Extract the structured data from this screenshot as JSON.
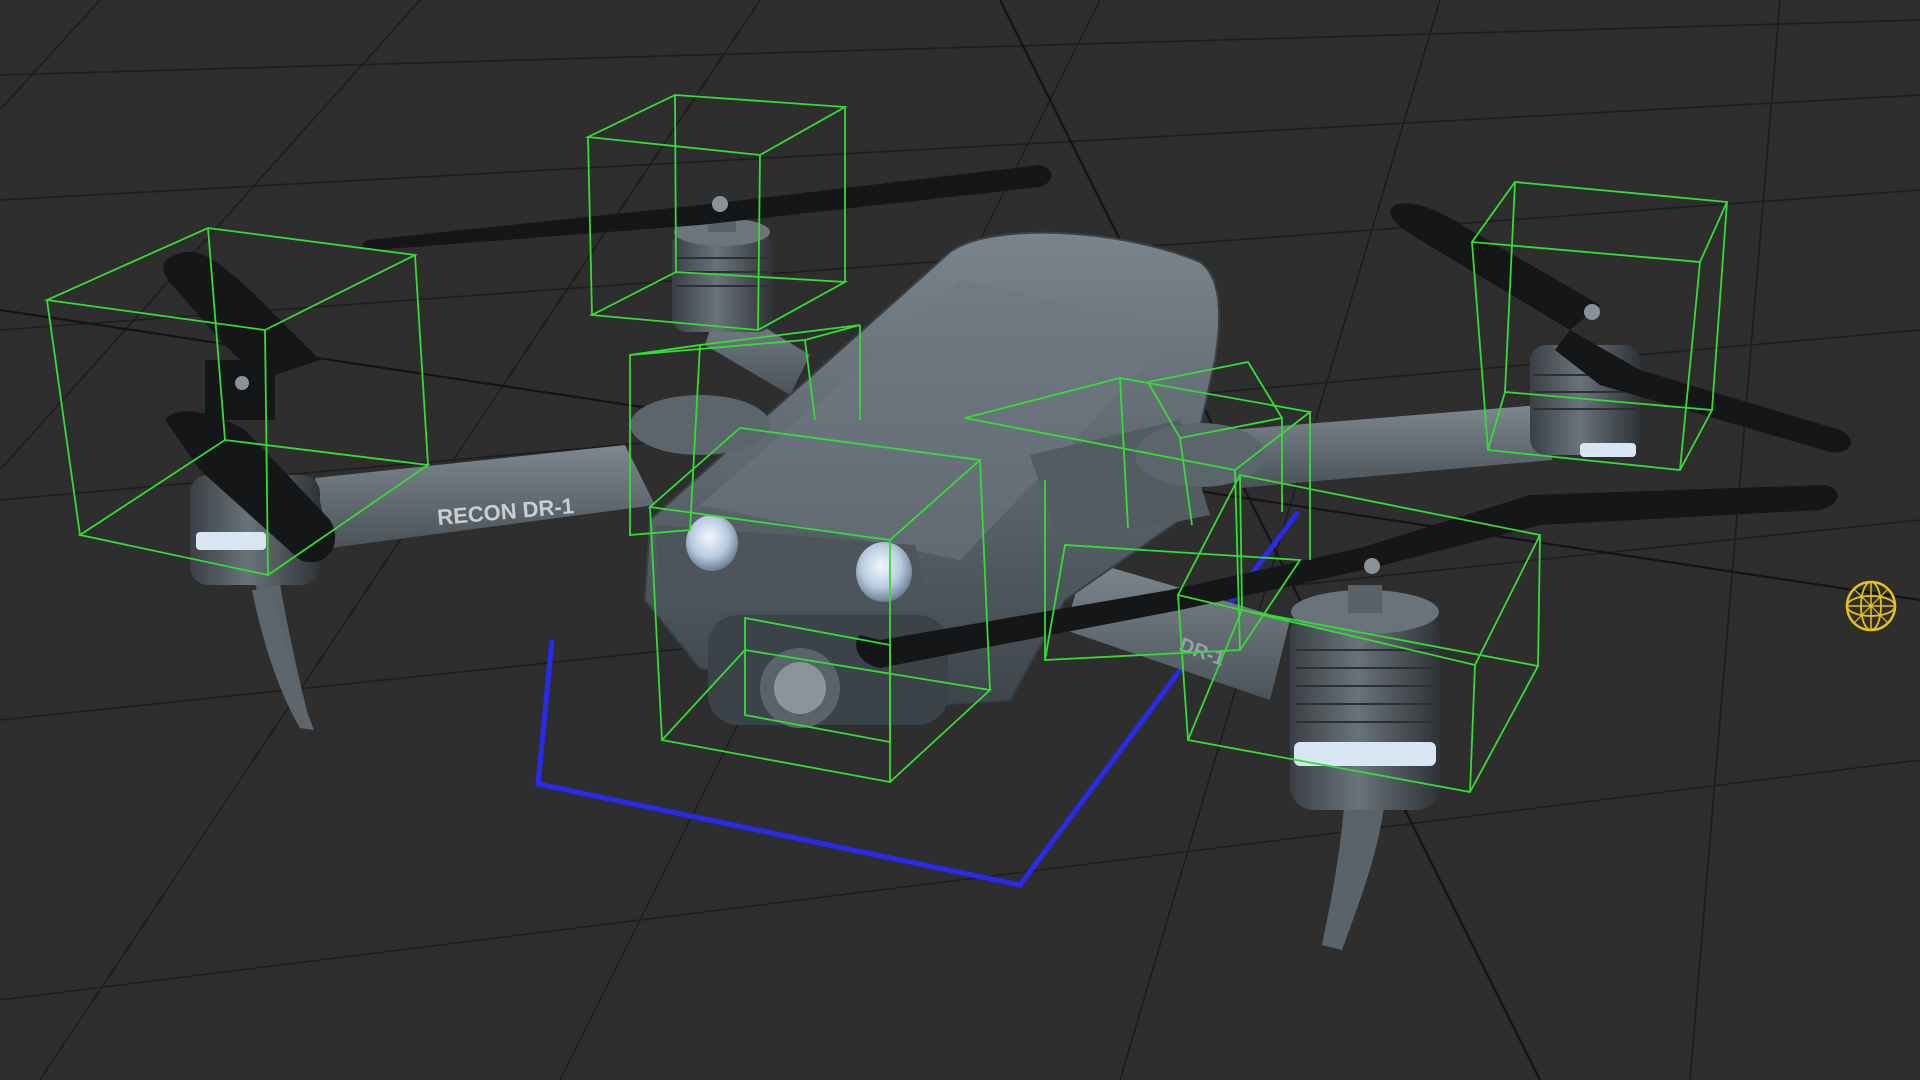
{
  "viewport": {
    "background": "#2e2e2e",
    "grid_color": "#1c1c1c",
    "axis_color": "#141414"
  },
  "model": {
    "arm_label": "RECON DR-1",
    "arm_label_rear": "DR-1",
    "body_color": "#5f6870",
    "propeller_color": "#141618",
    "led_color": "#d8e6f4"
  },
  "overlays": {
    "collision_box_color": "#33dd33",
    "ground_footprint_color": "#2a2aee",
    "light_gizmo_color": "#e8c218",
    "light_gizmo_icon": "point-light-icon"
  }
}
